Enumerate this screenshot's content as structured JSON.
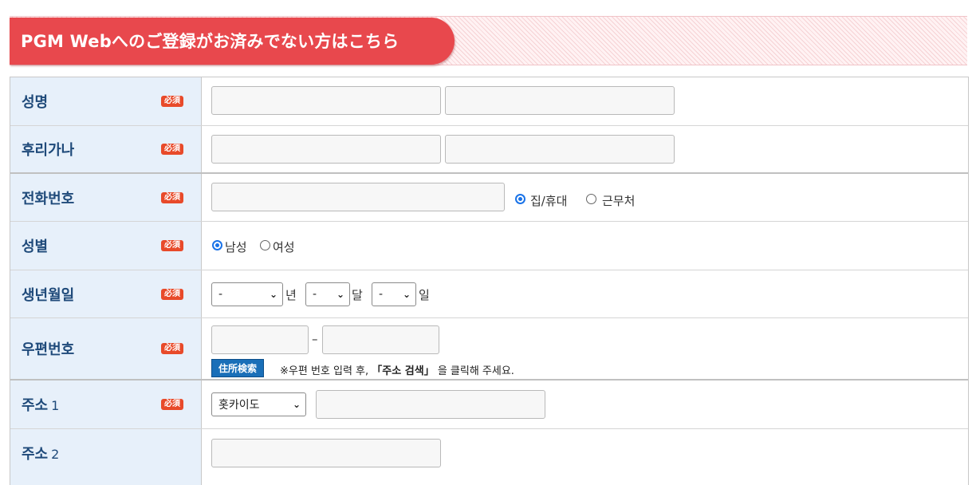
{
  "header": {
    "title": "PGM Webへのご登録がお済みでない方はこちら"
  },
  "required_badge": "必須",
  "rows": {
    "name": {
      "label": "성명"
    },
    "furigana": {
      "label": "후리가나"
    },
    "phone": {
      "label": "전화번호",
      "radio_home": "집/휴대",
      "radio_work": "근무처",
      "selected": "집/휴대"
    },
    "gender": {
      "label": "성별",
      "radio_male": "남성",
      "radio_female": "여성",
      "selected": "남성"
    },
    "birth": {
      "label": "생년월일",
      "year_value": "-",
      "year_unit": "년",
      "month_value": "-",
      "month_unit": "달",
      "day_value": "-",
      "day_unit": "일"
    },
    "zip": {
      "label": "우편번호",
      "dash": "–",
      "search_button": "住所検索",
      "note_prefix": "※우편 번호 입력 후,",
      "note_bold": "「주소 검색」",
      "note_suffix": "을 클릭해 주세요."
    },
    "address1": {
      "label": "주소",
      "label_num": "1",
      "prefecture_value": "홋카이도"
    },
    "address2": {
      "label": "주소",
      "label_num": "2"
    }
  },
  "colors": {
    "accent": "#e8484d",
    "label_bg": "#e7f0fa",
    "label_text": "#1f4a7a",
    "required": "#e84a2a",
    "button": "#1a6fb8"
  }
}
